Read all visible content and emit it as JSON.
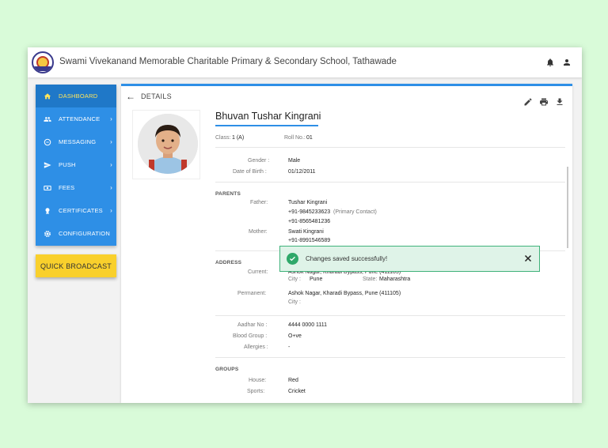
{
  "header": {
    "school_name": "Swami Vivekanand Memorable Charitable Primary & Secondary School, Tathawade",
    "icons": [
      "bell-icon",
      "user-icon"
    ]
  },
  "sidebar": {
    "items": [
      {
        "label": "DASHBOARD",
        "icon": "home-icon",
        "active": true
      },
      {
        "label": "ATTENDANCE",
        "icon": "people-icon",
        "chevron": "›"
      },
      {
        "label": "MESSAGING",
        "icon": "message-icon",
        "chevron": "›"
      },
      {
        "label": "PUSH",
        "icon": "send-icon",
        "chevron": "›"
      },
      {
        "label": "FEES",
        "icon": "money-icon",
        "chevron": "›"
      },
      {
        "label": "CERTIFICATES",
        "icon": "certificate-icon",
        "chevron": "›"
      },
      {
        "label": "CONFIGURATION",
        "icon": "gear-icon"
      }
    ],
    "broadcast_label": "QUICK BROADCAST"
  },
  "details": {
    "title": "DETAILS",
    "actions": [
      "edit-icon",
      "print-icon",
      "download-icon"
    ],
    "student_name": "Bhuvan Tushar Kingrani",
    "class_label": "Class:",
    "class_value": "1 (A)",
    "roll_label": "Roll No.:",
    "roll_value": "01",
    "gender_label": "Gender :",
    "gender_value": "Male",
    "dob_label": "Date of Birth :",
    "dob_value": "01/12/2011",
    "parents": {
      "heading": "PARENTS",
      "father_label": "Father:",
      "father_name": "Tushar Kingrani",
      "father_phone1": "+91-9845233623",
      "primary_note": "(Primary Contact)",
      "father_phone2": "+91-8565481236",
      "mother_label": "Mother:",
      "mother_name": "Swati Kingrani",
      "mother_phone": "+91-8991546589"
    },
    "address": {
      "heading": "ADDRESS",
      "current_label": "Current:",
      "current_value": "Ashok Nagar, Kharadi Bypass, Pune  (411105)",
      "city_label": "City :",
      "city_value": "Pune",
      "state_label": "State:",
      "state_value": "Maharashtra",
      "permanent_label": "Permanent:",
      "permanent_value": "Ashok Nagar, Kharadi Bypass, Pune  (411105)",
      "perm_city_label": "City :"
    },
    "other": {
      "aadhar_label": "Aadhar No :",
      "aadhar_value": "4444 0000 1111",
      "blood_label": "Blood Group :",
      "blood_value": "O+ve",
      "allergies_label": "Allergies :",
      "allergies_value": "-"
    },
    "groups": {
      "heading": "GROUPS",
      "house_label": "House:",
      "house_value": "Red",
      "sports_label": "Sports:",
      "sports_value": "Cricket"
    }
  },
  "toast": {
    "message": "Changes saved successfully!"
  },
  "colors": {
    "background": "#d9fbd9",
    "primary": "#2e8fe6",
    "active_text": "#ffe55c",
    "broadcast": "#f9d02c",
    "success": "#2fa86a"
  }
}
